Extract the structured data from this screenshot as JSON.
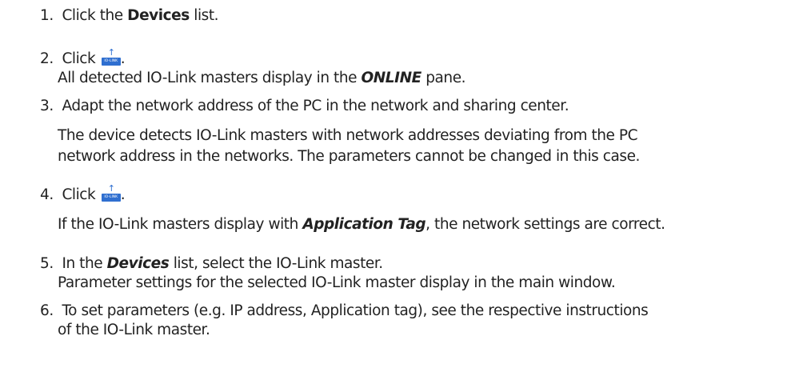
{
  "steps": [
    {
      "num": "1.",
      "pre": "Click the ",
      "bold": "Devices",
      "post": " list."
    },
    {
      "num": "2.",
      "pre": "Click ",
      "post": ".",
      "result": "All detected IO-Link masters display in the ",
      "result_emph": "ONLINE",
      "result_post": " pane."
    },
    {
      "num": "3.",
      "text": "Adapt the network address of the PC in the network and sharing center.",
      "note_line1": "The device detects IO-Link masters with network addresses deviating from the PC",
      "note_line2": "network address in the networks. The parameters cannot be changed in this case."
    },
    {
      "num": "4.",
      "pre": "Click ",
      "post": ".",
      "result_pre": "If the IO-Link masters display with ",
      "result_emph": "Application Tag",
      "result_post": ", the network settings are correct."
    },
    {
      "num": "5.",
      "pre": "In the ",
      "emph": "Devices",
      "post": " list, select the IO-Link master.",
      "result": "Parameter settings for the selected IO-Link master display in the main window."
    },
    {
      "num": "6.",
      "line1": "To set parameters (e.g. IP address, Application tag), see the respective instructions",
      "line2": "of the IO-Link master."
    }
  ],
  "icon": {
    "name": "io-link-upload-icon",
    "label": "IO-LINK",
    "arrow": "↑",
    "color": "#2f6fd0"
  }
}
